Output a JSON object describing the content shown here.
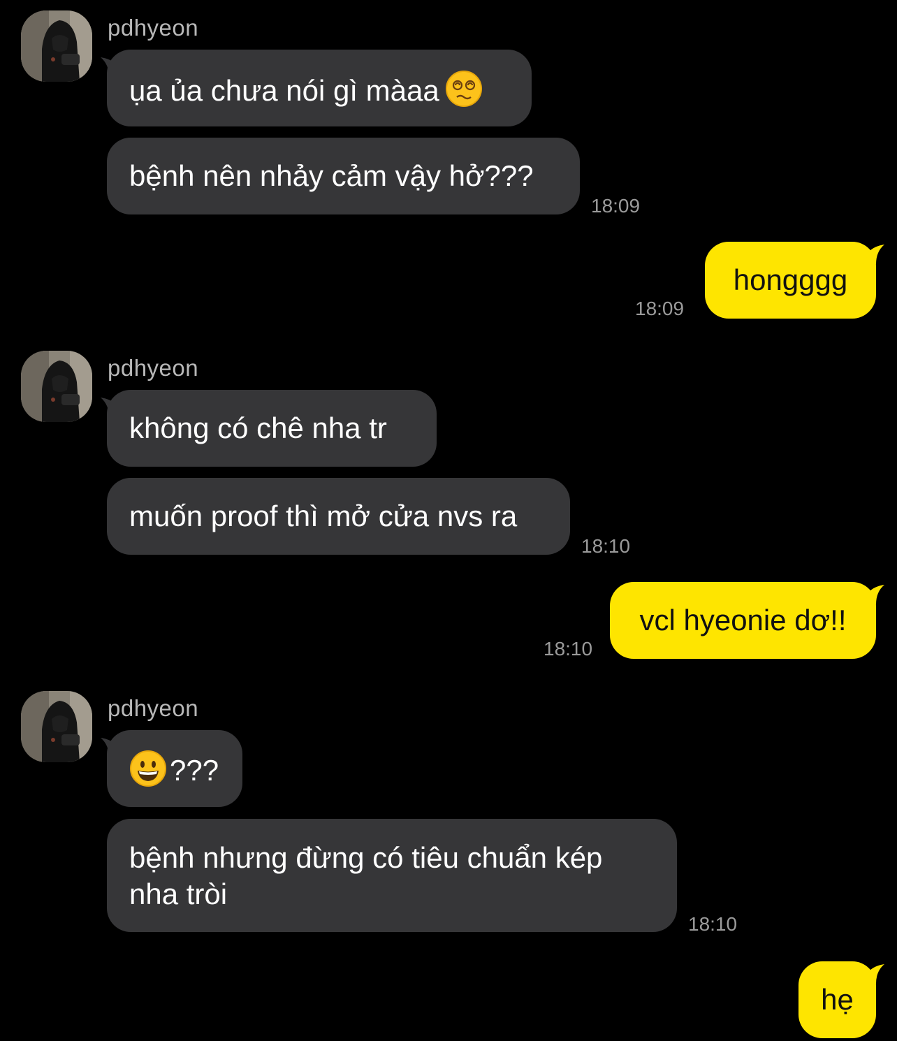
{
  "colors": {
    "background": "#000000",
    "incoming_bubble": "#363638",
    "outgoing_bubble": "#fee500",
    "timestamp": "#9a9a9a",
    "sender_name": "#b8b8b8"
  },
  "messages": [
    {
      "sender": "pdhyeon",
      "bubbles": [
        {
          "text": "ụa ủa chưa nói gì màaa",
          "emoji": "dizzy-face-icon"
        },
        {
          "text": "bệnh nên nhảy cảm vậy hở???"
        }
      ],
      "time": "18:09"
    },
    {
      "from_me": true,
      "text": "hongggg",
      "time": "18:09"
    },
    {
      "sender": "pdhyeon",
      "bubbles": [
        {
          "text": "không có chê nha tr"
        },
        {
          "text": "muốn proof thì mở cửa nvs ra"
        }
      ],
      "time": "18:10"
    },
    {
      "from_me": true,
      "text": "vcl hyeonie dơ!!",
      "time": "18:10"
    },
    {
      "sender": "pdhyeon",
      "bubbles": [
        {
          "text": "???",
          "emoji": "grinning-face-icon"
        },
        {
          "text_line1": "bệnh nhưng đừng có tiêu chuẩn kép",
          "text_line2": "nha tròi"
        }
      ],
      "time": "18:10"
    },
    {
      "from_me": true,
      "text": "hẹ"
    }
  ]
}
